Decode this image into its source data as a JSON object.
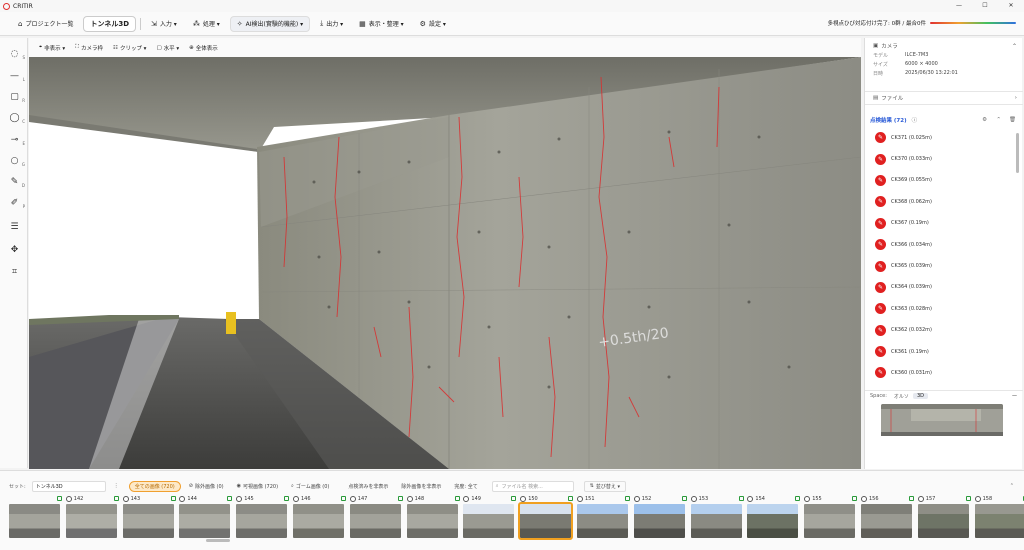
{
  "app": {
    "title": "CRITIR"
  },
  "window": {
    "minimize": "—",
    "maximize": "☐",
    "close": "✕"
  },
  "toolbar": {
    "items": [
      {
        "label": "プロジェクト一覧",
        "icon": "home-icon"
      },
      {
        "label": "トンネル3D",
        "icon": ""
      },
      {
        "label": "入力 ▾",
        "icon": "import-icon"
      },
      {
        "label": "処理 ▾",
        "icon": "process-icon"
      },
      {
        "label": "AI検出(實験的機能) ▾",
        "icon": "ai-icon"
      },
      {
        "label": "出力 ▾",
        "icon": "export-icon"
      },
      {
        "label": "表示・整理 ▾",
        "icon": "view-icon"
      },
      {
        "label": "設定 ▾",
        "icon": "gear-icon"
      }
    ],
    "progress_text": "多視点ひび対応付け完了: 0群 / 最合0件"
  },
  "left_tools": [
    {
      "icon": "orbit-icon",
      "key": "S"
    },
    {
      "icon": "line-tool-icon",
      "key": "L"
    },
    {
      "icon": "rect-tool-icon",
      "key": "R"
    },
    {
      "icon": "lasso-tool-icon",
      "key": "C"
    },
    {
      "icon": "slice-tool-icon",
      "key": "E"
    },
    {
      "icon": "circle-tool-icon",
      "key": "G"
    },
    {
      "icon": "pen-tool-icon",
      "key": "D"
    },
    {
      "icon": "edit-tool-icon",
      "key": "P"
    },
    {
      "icon": "settings-sliders-icon",
      "key": ""
    },
    {
      "icon": "move-icon",
      "key": ""
    },
    {
      "icon": "focus-icon",
      "key": ""
    }
  ],
  "viewbar": {
    "items": [
      {
        "label": "非表示 ▾",
        "icon": "tag-icon"
      },
      {
        "label": "カメラ枠",
        "icon": "frame-icon"
      },
      {
        "label": "クリップ ▾",
        "icon": "clip-icon"
      },
      {
        "label": "水平 ▾",
        "icon": "square-icon"
      },
      {
        "label": "全体表示",
        "icon": "fit-icon"
      }
    ]
  },
  "viewport": {
    "wall_text": "+0.5th/20"
  },
  "right_panel": {
    "camera": {
      "title": "カメラ",
      "rows": [
        {
          "key": "モデル",
          "value": "ILCE-7M3"
        },
        {
          "key": "サイズ",
          "value": "6000 × 4000"
        },
        {
          "key": "日時",
          "value": "2025/06/30 13:22:01"
        }
      ]
    },
    "file_label": "ファイル",
    "results": {
      "title": "点検結果 (72)",
      "items": [
        "CK371 (0.025m)",
        "CK370 (0.033m)",
        "CK369 (0.055m)",
        "CK368 (0.062m)",
        "CK367 (0.19m)",
        "CK366 (0.034m)",
        "CK365 (0.039m)",
        "CK364 (0.039m)",
        "CK363 (0.028m)",
        "CK362 (0.032m)",
        "CK361 (0.19m)",
        "CK360 (0.031m)"
      ]
    },
    "space": {
      "label": "Space:",
      "tabs": [
        "オルソ",
        "3D"
      ],
      "active": "3D"
    }
  },
  "bottom": {
    "set_label": "セット:",
    "set_value": "トンネル3D",
    "filters": [
      {
        "label": "全ての画像 (720)",
        "selected": true
      },
      {
        "label": "除外画像 (0)",
        "selected": false
      },
      {
        "label": "可視画像 (720)",
        "selected": false
      },
      {
        "label": "ゴーム画像 (0)",
        "selected": false
      },
      {
        "label": "点検済みを非表示",
        "selected": false
      },
      {
        "label": "除外画像を非表示",
        "selected": false
      },
      {
        "label": "完度: 全て",
        "selected": false
      }
    ],
    "search_placeholder": "ファイル名 検索...",
    "sort_label": "並び替え ▾",
    "thumbs": [
      "",
      "142",
      "143",
      "144",
      "145",
      "146",
      "147",
      "148",
      "149",
      "150",
      "151",
      "152",
      "153",
      "154",
      "155",
      "156",
      "157",
      "158"
    ],
    "selected_thumb": "150"
  },
  "colors": {
    "accent": "#f0a020",
    "crack": "#e02020",
    "link": "#2a5bd7"
  }
}
